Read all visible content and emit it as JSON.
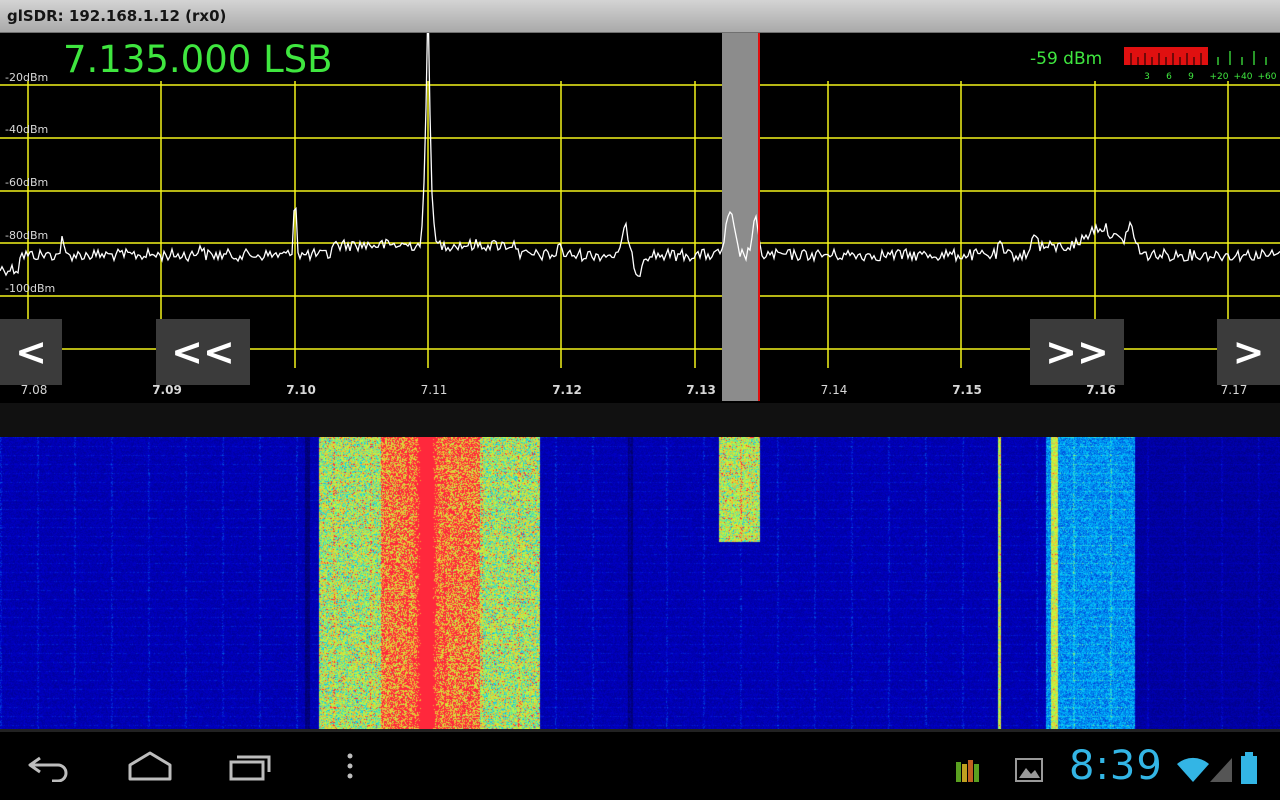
{
  "window": {
    "title": "glSDR: 192.168.1.12 (rx0)"
  },
  "tuning": {
    "frequency_mode": "7.135.000 LSB"
  },
  "signal": {
    "level": "-59 dBm",
    "meter_scale": [
      "3",
      "6",
      "9",
      "+20",
      "+40",
      "+60"
    ]
  },
  "spectrum": {
    "db_labels": [
      "-20dBm",
      "-40dBm",
      "-60dBm",
      "-80dBm",
      "-100dBm"
    ],
    "freq_labels": [
      "7.08",
      "7.09",
      "7.10",
      "7.11",
      "7.12",
      "7.13",
      "7.14",
      "7.15",
      "7.16",
      "7.17"
    ]
  },
  "buttons": {
    "step_left": "<",
    "fast_left": "<<",
    "fast_right": ">>",
    "step_right": ">"
  },
  "status": {
    "clock": "8:39"
  },
  "colors": {
    "grid": "#f2f21a",
    "trace": "#ffffff",
    "readout": "#3fe63f",
    "marker": "#e01010",
    "clock": "#33b5e5"
  },
  "icons": {
    "back": "back-arrow-icon",
    "home": "home-icon",
    "recents": "recent-apps-icon",
    "menu": "overflow-menu-icon",
    "app_status": "app-bars-icon",
    "gallery": "image-icon",
    "wifi": "wifi-icon",
    "cell": "cell-signal-icon",
    "battery": "battery-icon"
  }
}
